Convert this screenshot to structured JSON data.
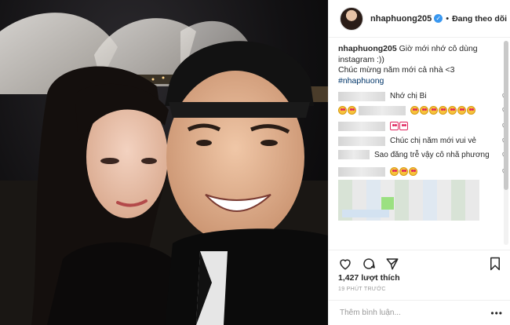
{
  "post": {
    "username": "nhaphuong205",
    "follow_state": "Đang theo dõi",
    "separator": "•",
    "caption_username": "nhaphuong205",
    "caption_line1": " Giờ mới nhớ cô dùng instagram :))",
    "caption_line2": "Chúc mừng năm mới cả nhà <3",
    "hashtag": "#nhaphuong"
  },
  "comments": [
    {
      "text": "Nhớ chị Bi",
      "emojis": 0
    },
    {
      "text": "",
      "emojis": 7,
      "lead_emojis": 2
    },
    {
      "text": "",
      "emojis": 2,
      "emoji_style": "square"
    },
    {
      "text": "Chúc chị năm mới vui vẻ",
      "emojis": 0
    },
    {
      "text": "Sao đăng trễ vậy cô nhã phương",
      "emojis": 0
    },
    {
      "text": "",
      "emojis": 3
    }
  ],
  "stats": {
    "likes": "1,427 lượt thích",
    "time_ago": "19 PHÚT TRƯỚC"
  },
  "input": {
    "placeholder": "Thêm bình luận...",
    "more": "•••"
  },
  "icons": {
    "verified": "verified-badge-icon",
    "like": "heart-icon",
    "comment": "comment-icon",
    "share": "share-icon",
    "save": "bookmark-icon",
    "more": "more-options-icon"
  },
  "colors": {
    "verified": "#3897f0",
    "hashtag": "#003569",
    "muted": "#999999"
  }
}
